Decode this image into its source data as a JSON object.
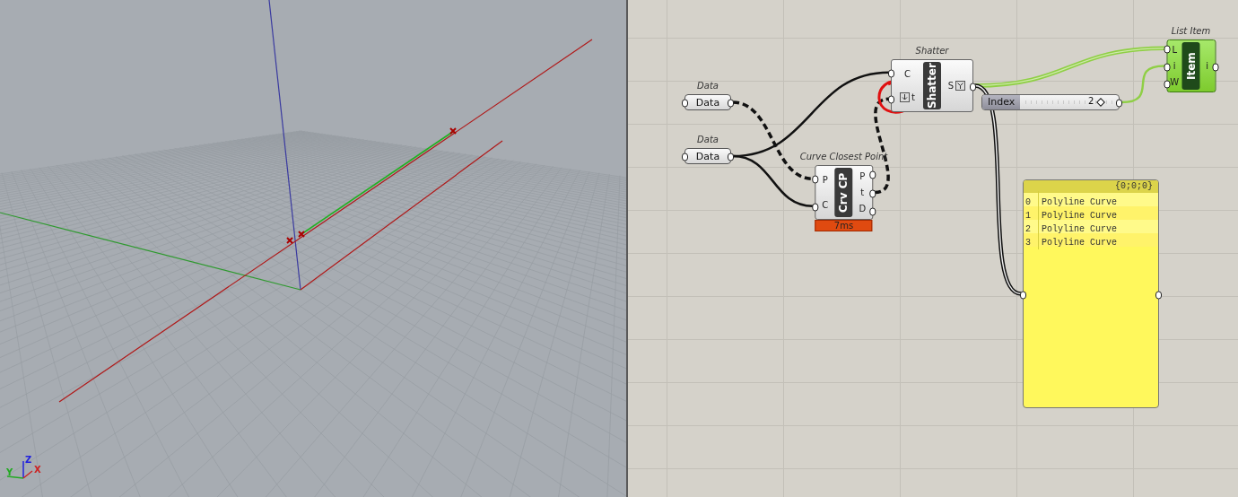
{
  "viewport": {
    "gizmo": {
      "z": "Z",
      "y": "Y",
      "x": "X"
    }
  },
  "canvas": {
    "params": [
      {
        "title": "Data",
        "label": "Data"
      },
      {
        "title": "Data",
        "label": "Data"
      }
    ],
    "components": [
      {
        "title": "Shatter",
        "label": "Shatter",
        "selected": false,
        "inputs": [
          {
            "name": "C",
            "flatten": false
          },
          {
            "name": "t",
            "flatten": true
          }
        ],
        "outputs": [
          {
            "name": "S",
            "graft": true
          }
        ]
      },
      {
        "title": "Curve Closest Point",
        "label": "Crv CP",
        "selected": false,
        "timer": "7ms",
        "inputs": [
          {
            "name": "P"
          },
          {
            "name": "C"
          }
        ],
        "outputs": [
          {
            "name": "P"
          },
          {
            "name": "t"
          },
          {
            "name": "D"
          }
        ]
      },
      {
        "title": "List Item",
        "label": "Item",
        "selected": true,
        "inputs": [
          {
            "name": "L"
          },
          {
            "name": "i"
          },
          {
            "name": "W"
          }
        ],
        "outputs": [
          {
            "name": "i"
          }
        ]
      }
    ],
    "slider": {
      "label": "Index",
      "value": "2",
      "level": 0.86
    },
    "panel": {
      "path": "{0;0;0}",
      "items": [
        {
          "index": "0",
          "text": "Polyline Curve"
        },
        {
          "index": "1",
          "text": "Polyline Curve"
        },
        {
          "index": "2",
          "text": "Polyline Curve"
        },
        {
          "index": "3",
          "text": "Polyline Curve"
        }
      ]
    }
  }
}
